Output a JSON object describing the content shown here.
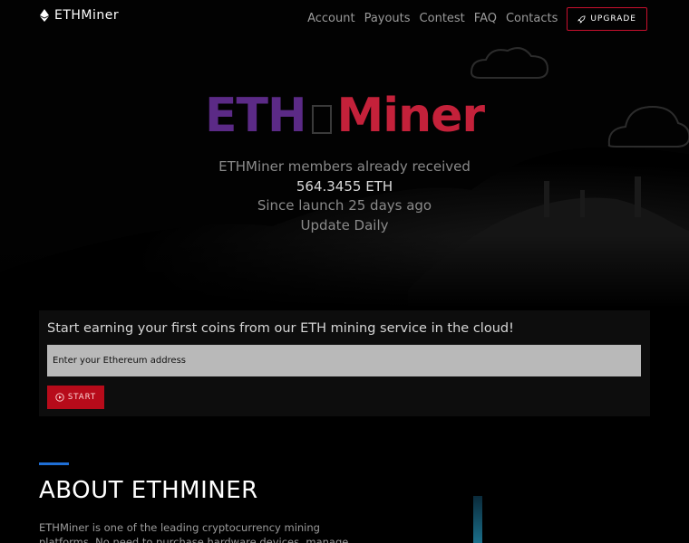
{
  "brand": {
    "name": "ETHMiner",
    "logo_icon": "ethereum-icon"
  },
  "nav": {
    "links": [
      "Account",
      "Payouts",
      "Contest",
      "FAQ",
      "Contacts"
    ],
    "upgrade_label": "UPGRADE",
    "upgrade_icon": "rocket-icon"
  },
  "hero": {
    "title_left": "ETH",
    "title_right": "Miner",
    "line1": "ETHMiner members already received",
    "amount": "564.3455 ETH",
    "since": "Since launch 25 days ago",
    "update": "Update Daily"
  },
  "earn": {
    "title": "Start earning your first coins from our ETH mining service in the cloud!",
    "input_placeholder": "Enter your Ethereum address",
    "input_value": "",
    "start_label": "START",
    "start_icon": "play-circle-icon"
  },
  "about": {
    "title": "ABOUT ETHMINER",
    "text": "ETHMiner is one of the leading cryptocurrency mining platforms. No need to purchase hardware devices, manage devices, offering"
  },
  "colors": {
    "background": "#000000",
    "eth_purple": "#5b2a86",
    "miner_red": "#c4213a",
    "upgrade_border": "#c8102e",
    "start_bg": "#b70b1a",
    "input_bg": "#b9b9b9",
    "about_bar": "#1f6fd6"
  }
}
